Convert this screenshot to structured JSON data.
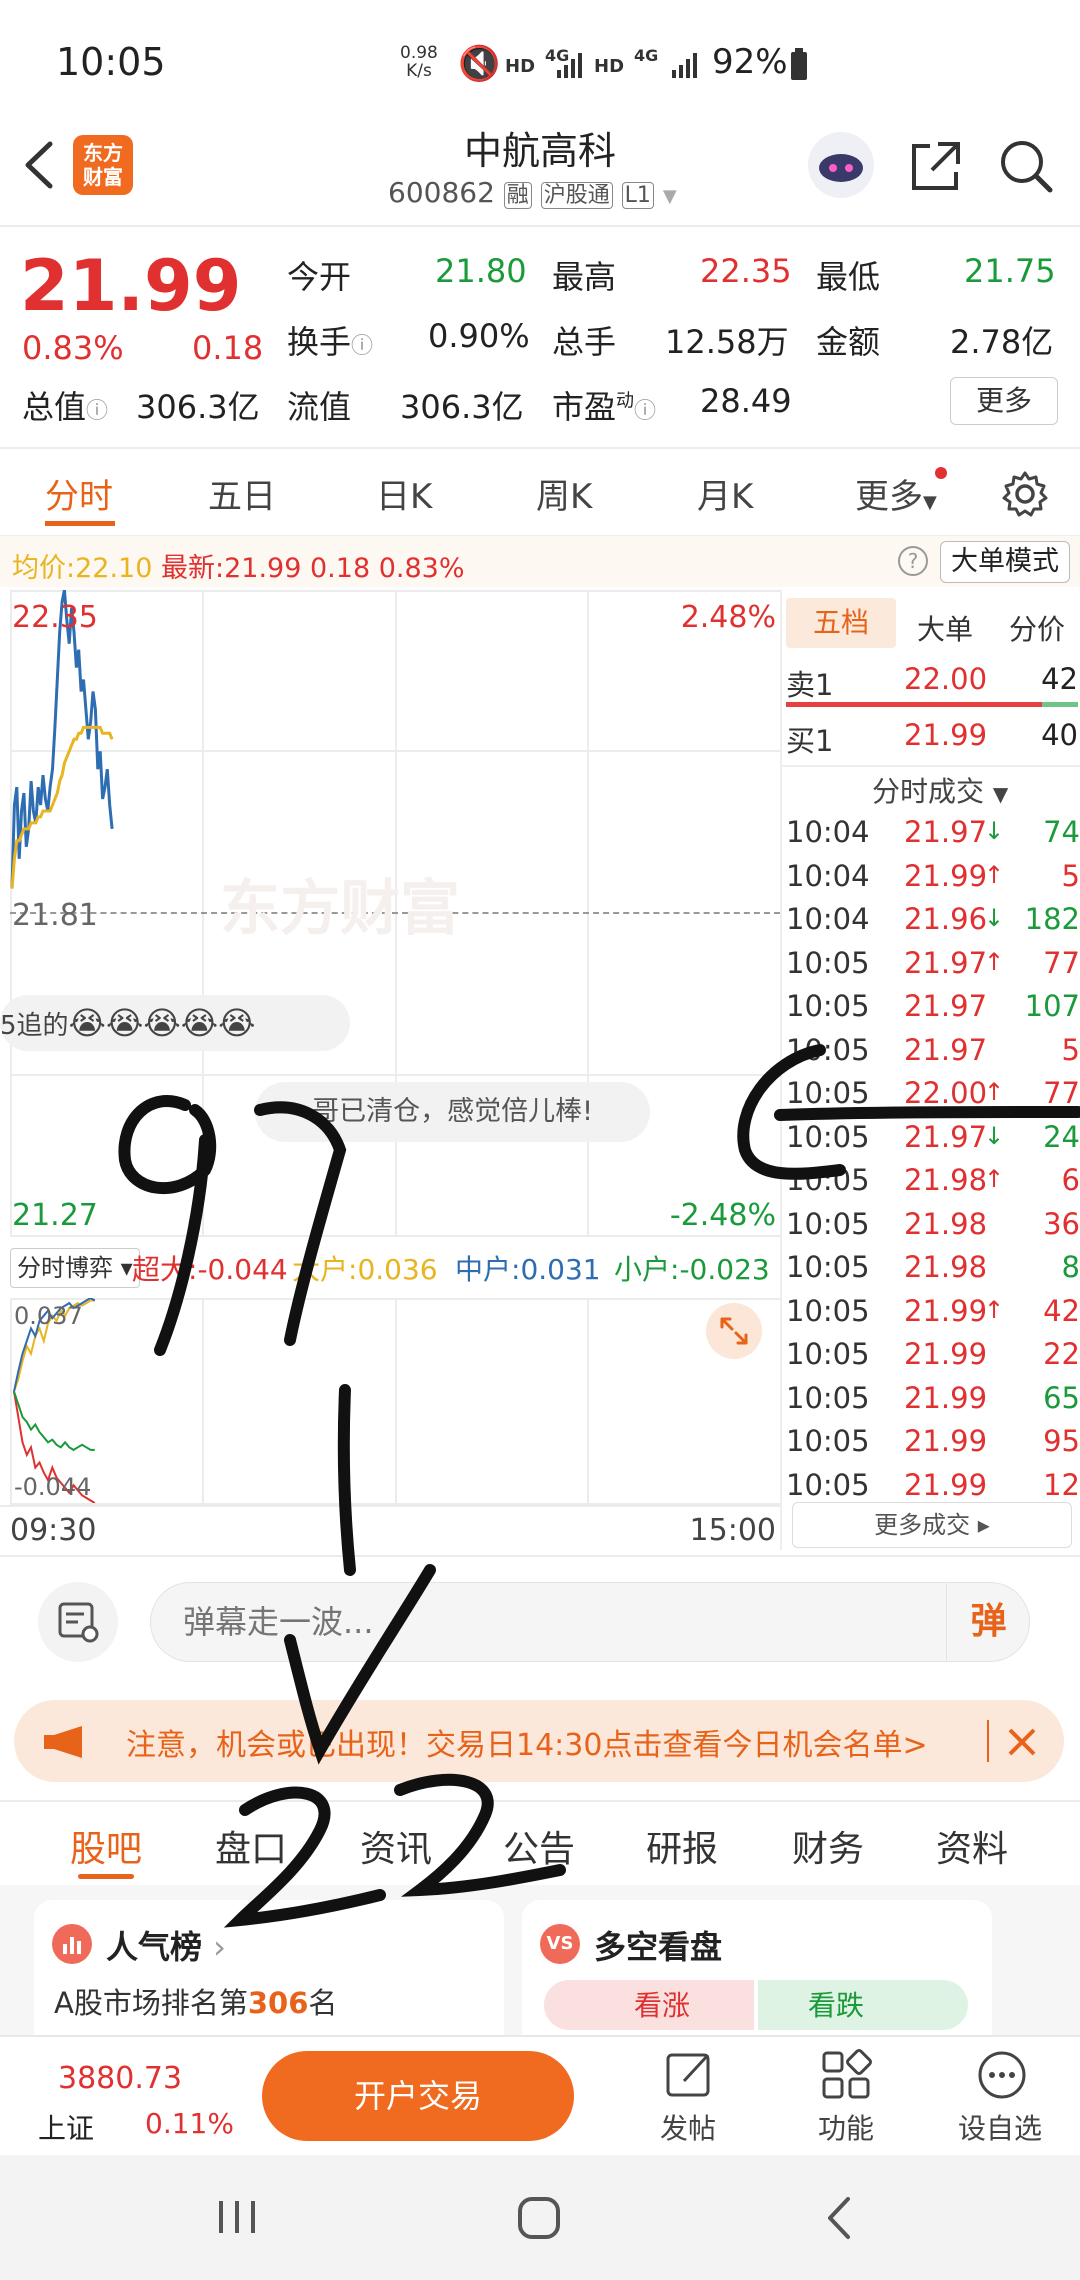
{
  "status_bar": {
    "time": "10:05",
    "net_speed_top": "0.98",
    "net_speed_bottom": "K/s",
    "hd1": "HD",
    "sig1": "4G",
    "hd2": "HD",
    "sig2": "4G",
    "battery": "92%"
  },
  "header": {
    "logo_line1": "东方",
    "logo_line2": "财富",
    "stock_name": "中航高科",
    "stock_code": "600862",
    "tag_rong": "融",
    "tag_hgt": "沪股通",
    "tag_level": "L1"
  },
  "quote": {
    "price": "21.99",
    "change_pct": "0.83%",
    "change": "0.18",
    "open_label": "今开",
    "open": "21.80",
    "high_label": "最高",
    "high": "22.35",
    "low_label": "最低",
    "low": "21.75",
    "turnover_label": "换手",
    "turnover": "0.90%",
    "volume_label": "总手",
    "volume": "12.58万",
    "amount_label": "金额",
    "amount": "2.78亿",
    "mktcap_label": "总值",
    "mktcap": "306.3亿",
    "float_label": "流值",
    "float": "306.3亿",
    "pe_label": "市盈",
    "pe_super": "动",
    "pe": "28.49",
    "more_label": "更多"
  },
  "tabs": [
    "分时",
    "五日",
    "日K",
    "周K",
    "月K",
    "更多"
  ],
  "active_tab": 0,
  "info_bar": {
    "avg_label": "均价:",
    "avg": "22.10",
    "latest_label": "最新:",
    "latest": "21.99",
    "chg": "0.18",
    "chg_pct": "0.83%",
    "big_order_mode": "大单模式"
  },
  "chart_data": {
    "type": "line",
    "title": "",
    "y_top_label": "22.35",
    "y_mid_label": "21.81",
    "y_bottom_label": "21.27",
    "pct_top_label": "2.48%",
    "pct_bottom_label": "-2.48%",
    "ylim": [
      21.27,
      22.35
    ],
    "prev_close": 21.81,
    "x_start_label": "09:30",
    "x_end_label": "15:00",
    "watermark": "东方财富",
    "series": [
      {
        "values": [
          21.85,
          21.99,
          22.02,
          21.9,
          21.98,
          22.01,
          21.92,
          21.95,
          22.03,
          21.98,
          21.96,
          22.02,
          21.99,
          22.04,
          22.0,
          21.98,
          22.02,
          22.05,
          22.12,
          22.2,
          22.28,
          22.33,
          22.35,
          22.3,
          22.26,
          22.32,
          22.28,
          22.22,
          22.25,
          22.18,
          22.2,
          22.15,
          22.1,
          22.13,
          22.18,
          22.15,
          22.05,
          22.08,
          22.0,
          22.02,
          22.05,
          21.99,
          21.95
        ]
      },
      {
        "values": [
          21.85,
          21.9,
          21.93,
          21.93,
          21.94,
          21.95,
          21.95,
          21.95,
          21.96,
          21.96,
          21.96,
          21.97,
          21.97,
          21.98,
          21.98,
          21.98,
          21.98,
          21.99,
          22.0,
          22.01,
          22.03,
          22.04,
          22.06,
          22.07,
          22.08,
          22.09,
          22.1,
          22.1,
          22.11,
          22.11,
          22.12,
          22.12,
          22.12,
          22.12,
          22.12,
          22.12,
          22.12,
          22.12,
          22.11,
          22.11,
          22.11,
          22.11,
          22.1
        ]
      }
    ],
    "indicator": {
      "label": "分时博弈",
      "items": [
        {
          "name": "超大:",
          "value": "-0.044"
        },
        {
          "name": "大户:",
          "value": "0.036"
        },
        {
          "name": "中户:",
          "value": "0.031"
        },
        {
          "name": "小户:",
          "value": "-0.023"
        }
      ],
      "y_top_label": "0.037",
      "y_bottom_label": "-0.044",
      "ylim": [
        -0.044,
        0.037
      ],
      "series": [
        {
          "values": [
            0.0,
            -0.01,
            -0.02,
            -0.025,
            -0.022,
            -0.03,
            -0.028,
            -0.032,
            -0.035,
            -0.03,
            -0.034,
            -0.036,
            -0.038,
            -0.04,
            -0.037,
            -0.039,
            -0.041,
            -0.042,
            -0.043,
            -0.044
          ]
        },
        {
          "values": [
            0.0,
            0.005,
            0.012,
            0.018,
            0.015,
            0.022,
            0.025,
            0.02,
            0.027,
            0.03,
            0.028,
            0.032,
            0.03,
            0.033,
            0.034,
            0.035,
            0.034,
            0.035,
            0.036,
            0.036
          ]
        },
        {
          "values": [
            0.0,
            0.008,
            0.015,
            0.02,
            0.025,
            0.022,
            0.028,
            0.03,
            0.032,
            0.029,
            0.031,
            0.033,
            0.034,
            0.035,
            0.033,
            0.034,
            0.035,
            0.036,
            0.037,
            0.036
          ]
        },
        {
          "values": [
            0.0,
            -0.005,
            -0.01,
            -0.012,
            -0.015,
            -0.013,
            -0.016,
            -0.018,
            -0.02,
            -0.019,
            -0.021,
            -0.022,
            -0.02,
            -0.022,
            -0.023,
            -0.022,
            -0.021,
            -0.022,
            -0.023,
            -0.023
          ]
        }
      ]
    }
  },
  "comments": {
    "chase_text": "5追的",
    "bubble_text": "哥已清仓，感觉倍儿棒!"
  },
  "order_book": {
    "tabs": [
      "五档",
      "大单",
      "分价"
    ],
    "sell1_label": "卖1",
    "sell1_price": "22.00",
    "sell1_vol": "42",
    "buy1_label": "买1",
    "buy1_price": "21.99",
    "buy1_vol": "40",
    "ticks_header": "分时成交",
    "ticks": [
      {
        "time": "10:04",
        "price": "21.97",
        "dir": "down",
        "vol": "74"
      },
      {
        "time": "10:04",
        "price": "21.99",
        "dir": "up",
        "vol": "5"
      },
      {
        "time": "10:04",
        "price": "21.96",
        "dir": "down",
        "vol": "182"
      },
      {
        "time": "10:05",
        "price": "21.97",
        "dir": "up",
        "vol": "77"
      },
      {
        "time": "10:05",
        "price": "21.97",
        "dir": "",
        "vol": "107"
      },
      {
        "time": "10:05",
        "price": "21.97",
        "dir": "",
        "vol": "5"
      },
      {
        "time": "10:05",
        "price": "22.00",
        "dir": "up",
        "vol": "77"
      },
      {
        "time": "10:05",
        "price": "21.97",
        "dir": "down",
        "vol": "24"
      },
      {
        "time": "10:05",
        "price": "21.98",
        "dir": "up",
        "vol": "6"
      },
      {
        "time": "10:05",
        "price": "21.98",
        "dir": "",
        "vol": "36"
      },
      {
        "time": "10:05",
        "price": "21.98",
        "dir": "",
        "vol": "8"
      },
      {
        "time": "10:05",
        "price": "21.99",
        "dir": "up",
        "vol": "42"
      },
      {
        "time": "10:05",
        "price": "21.99",
        "dir": "",
        "vol": "22"
      },
      {
        "time": "10:05",
        "price": "21.99",
        "dir": "",
        "vol": "65"
      },
      {
        "time": "10:05",
        "price": "21.99",
        "dir": "",
        "vol": "95"
      },
      {
        "time": "10:05",
        "price": "21.99",
        "dir": "",
        "vol": "12"
      }
    ],
    "more_ticks": "更多成交"
  },
  "danmaku": {
    "placeholder": "弹幕走一波...",
    "send_label": "弹"
  },
  "notice": {
    "text": "注意，机会或已出现！交易日14:30点击查看今日机会名单>"
  },
  "sub_tabs": [
    "股吧",
    "盘口",
    "资讯",
    "公告",
    "研报",
    "财务",
    "资料"
  ],
  "active_sub_tab": 0,
  "cards": {
    "popularity_title": "人气榜",
    "popularity_text_prefix": "A股市场排名第",
    "popularity_rank": "306",
    "popularity_text_suffix": "名",
    "longshort_title": "多空看盘",
    "bull_label": "看涨",
    "bear_label": "看跌"
  },
  "bottom_nav": {
    "index_value": "3880.73",
    "index_name": "上证",
    "index_pct": "0.11%",
    "trade_button": "开户交易",
    "post_label": "发帖",
    "function_label": "功能",
    "watchlist_label": "设自选"
  },
  "colors": {
    "red": "#e03030",
    "green": "#1a9a3a",
    "accent": "#f06a1f",
    "price_line": "#2f6db3",
    "avg_line": "#e8b420"
  }
}
